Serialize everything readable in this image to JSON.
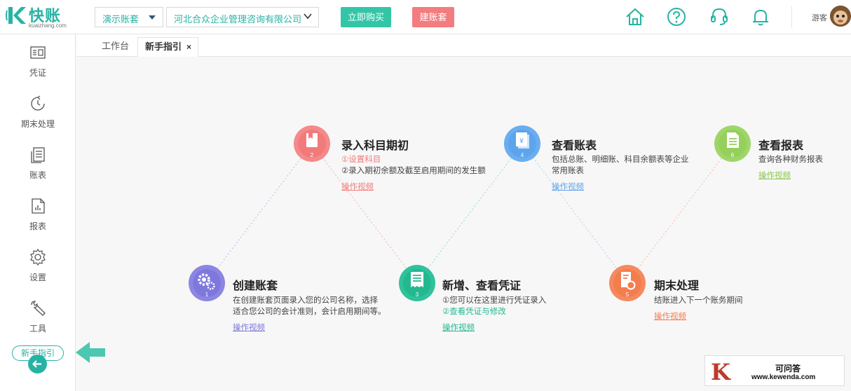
{
  "app": {
    "logo_text": "快账",
    "logo_domain": "kuaizhang.com"
  },
  "header": {
    "book_select": "演示账套",
    "company_select": "河北合众企业管理咨询有限公司",
    "buy_label": "立即购买",
    "create_label": "建账套",
    "user_name": "游客"
  },
  "sidebar": {
    "items": [
      {
        "label": "凭证"
      },
      {
        "label": "期末处理"
      },
      {
        "label": "账表"
      },
      {
        "label": "报表"
      },
      {
        "label": "设置"
      },
      {
        "label": "工具"
      }
    ],
    "guide_label": "新手指引"
  },
  "tabs": [
    {
      "label": "工作台"
    },
    {
      "label": "新手指引",
      "close": "×"
    }
  ],
  "steps": [
    {
      "num": "1",
      "title": "创建账套",
      "desc": [
        "在创建账套页面录入您的公司名称，选择",
        "适合您公司的会计准则，会计启用期间等。"
      ],
      "link": "操作视频",
      "color": "#8c86e3"
    },
    {
      "num": "2",
      "title": "录入科目期初",
      "desc": [
        "①设置科目",
        "②录入期初余额及截至启用期间的发生额"
      ],
      "link": "操作视频",
      "color": "#f48a8a"
    },
    {
      "num": "3",
      "title": "新增、查看凭证",
      "desc": [
        "①您可以在这里进行凭证录入",
        "②查看凭证与修改"
      ],
      "link": "操作视频",
      "color": "#2fc29c"
    },
    {
      "num": "4",
      "title": "查看账表",
      "desc": [
        "包括总账、明细账、科目余额表等企业",
        "常用账表"
      ],
      "link": "操作视频",
      "color": "#6aaef0"
    },
    {
      "num": "5",
      "title": "期末处理",
      "desc": [
        "结账进入下一个账务期间"
      ],
      "link": "操作视频",
      "color": "#f58a5e"
    },
    {
      "num": "6",
      "title": "查看报表",
      "desc": [
        "查询各种财务报表"
      ],
      "link": "操作视频",
      "color": "#9fd66a"
    }
  ],
  "watermark": {
    "letter": "K",
    "name": "可问答",
    "url": "www.kewenda.com"
  }
}
